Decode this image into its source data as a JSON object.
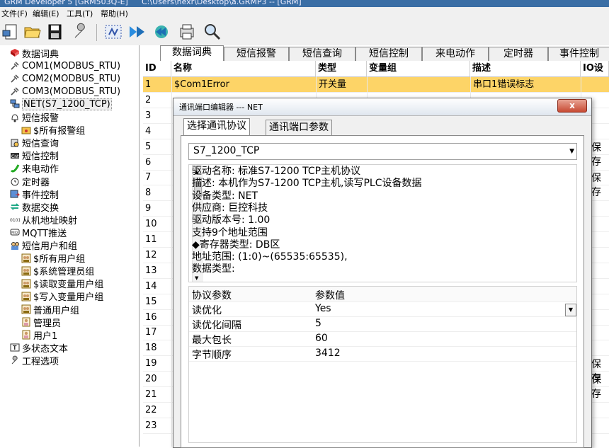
{
  "window": {
    "title": "GRM Developer 5 [GRM503Q-E]",
    "path": "C:\\Users\\hexr\\Desktop\\a.GRMP3 -- [GRM]"
  },
  "menu": [
    "文件(F)",
    "编辑(E)",
    "工具(T)",
    "帮助(H)"
  ],
  "tree": [
    {
      "label": "数据词典",
      "icon": "book-icon",
      "level": 0
    },
    {
      "label": "COM1(MODBUS_RTU)",
      "icon": "plug-icon",
      "level": 0
    },
    {
      "label": "COM2(MODBUS_RTU)",
      "icon": "plug-icon",
      "level": 0
    },
    {
      "label": "COM3(MODBUS_RTU)",
      "icon": "plug-icon",
      "level": 0
    },
    {
      "label": "NET(S7_1200_TCP)",
      "icon": "network-icon",
      "level": 0
    },
    {
      "label": "短信报警",
      "icon": "bell-icon",
      "level": 0
    },
    {
      "label": "$所有报警组",
      "icon": "folder-icon",
      "level": 1
    },
    {
      "label": "短信查询",
      "icon": "query-icon",
      "level": 0
    },
    {
      "label": "短信控制",
      "icon": "control-icon",
      "level": 0
    },
    {
      "label": "来电动作",
      "icon": "phone-icon",
      "level": 0
    },
    {
      "label": "定时器",
      "icon": "timer-icon",
      "level": 0
    },
    {
      "label": "事件控制",
      "icon": "event-icon",
      "level": 0
    },
    {
      "label": "数据交换",
      "icon": "exchange-icon",
      "level": 0
    },
    {
      "label": "从机地址映射",
      "icon": "map-icon",
      "level": 0
    },
    {
      "label": "MQTT推送",
      "icon": "mqtt-icon",
      "level": 0
    },
    {
      "label": "短信用户和组",
      "icon": "users-icon",
      "level": 0
    },
    {
      "label": "$所有用户组",
      "icon": "group-icon",
      "level": 1
    },
    {
      "label": "$系统管理员组",
      "icon": "group-icon",
      "level": 1
    },
    {
      "label": "$读取变量用户组",
      "icon": "group-icon",
      "level": 1
    },
    {
      "label": "$写入变量用户组",
      "icon": "group-icon",
      "level": 1
    },
    {
      "label": "普通用户组",
      "icon": "group-icon",
      "level": 1
    },
    {
      "label": "管理员",
      "icon": "user-icon",
      "level": 1
    },
    {
      "label": "用户1",
      "icon": "user-icon",
      "level": 1
    },
    {
      "label": "多状态文本",
      "icon": "text-icon",
      "level": 0
    },
    {
      "label": "工程选项",
      "icon": "wrench-icon",
      "level": 0
    }
  ],
  "tabs": [
    "数据词典",
    "短信报警",
    "短信查询",
    "短信控制",
    "来电动作",
    "定时器",
    "事件控制"
  ],
  "grid": {
    "headers": [
      "ID",
      "名称",
      "类型",
      "变量组",
      "描述",
      "IO设"
    ],
    "row_ids": [
      "1",
      "2",
      "3",
      "4",
      "5",
      "6",
      "7",
      "8",
      "9",
      "10",
      "11",
      "12",
      "13",
      "14",
      "15",
      "16",
      "17",
      "18",
      "19",
      "20",
      "21",
      "22",
      "23"
    ],
    "selected": {
      "id": "1",
      "name": "$Com1Error",
      "type": "开关量",
      "group": "",
      "desc": "串口1错误标志"
    },
    "right_col": [
      {
        "row": 5,
        "text": "保存"
      },
      {
        "row": 7,
        "text": "保存"
      },
      {
        "row": 19,
        "text": "保存"
      },
      {
        "row": 20,
        "text": "保存"
      }
    ]
  },
  "dialog": {
    "title": "通讯端口编辑器 --- NET",
    "close": "x",
    "tabs": [
      "选择通讯协议",
      "通讯端口参数"
    ],
    "protocol": "S7_1200_TCP",
    "info": [
      "驱动名称: 标准S7-1200 TCP主机协议",
      "描述: 本机作为S7-1200 TCP主机,读写PLC设备数据",
      "设备类型: NET",
      "供应商: 巨控科技",
      "驱动版本号: 1.00",
      "支持9个地址范围",
      "◆寄存器类型: DB区",
      "地址范围: (1:0)~(65535:65535),",
      "数据类型:"
    ],
    "params_header": [
      "协议参数",
      "参数值"
    ],
    "params": [
      {
        "name": "读优化",
        "value": "Yes"
      },
      {
        "name": "读优化间隔",
        "value": "5"
      },
      {
        "name": "最大包长",
        "value": "60"
      },
      {
        "name": "字节顺序",
        "value": "3412"
      }
    ]
  }
}
